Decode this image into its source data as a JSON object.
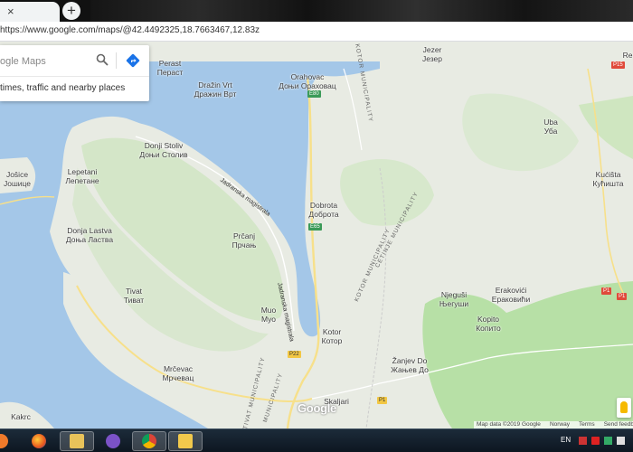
{
  "browser": {
    "url": "https://www.google.com/maps/@42.4492325,18.7663467,12.83z",
    "new_tab_symbol": "+",
    "tab_close_symbol": "×"
  },
  "search": {
    "placeholder": "ogle Maps",
    "hint": "times, traffic and nearby places"
  },
  "map": {
    "places": [
      {
        "latin": "Orahovac",
        "cyrillic": "Доњи Ораховац"
      },
      {
        "latin": "Jezer",
        "cyrillic": "Језер"
      },
      {
        "latin": "Perast",
        "cyrillic": "Пераст"
      },
      {
        "latin": "Dražin Vrt",
        "cyrillic": "Дражин Врт"
      },
      {
        "latin": "Donji Stoliv",
        "cyrillic": "Доњи Столив"
      },
      {
        "latin": "Uba",
        "cyrillic": "Уба"
      },
      {
        "latin": "Kućišta",
        "cyrillic": "Кућишта"
      },
      {
        "latin": "Lepetani",
        "cyrillic": "Лепетане"
      },
      {
        "latin": "Jošice",
        "cyrillic": "Јошице"
      },
      {
        "latin": "Dobrota",
        "cyrillic": "Доброта"
      },
      {
        "latin": "Donja Lastva",
        "cyrillic": "Доња Ластва"
      },
      {
        "latin": "Prčanj",
        "cyrillic": "Прчањ"
      },
      {
        "latin": "Tivat",
        "cyrillic": "Тиват"
      },
      {
        "latin": "Njeguši",
        "cyrillic": "Његуши"
      },
      {
        "latin": "Erakovići",
        "cyrillic": "Ераковићи"
      },
      {
        "latin": "Kopito",
        "cyrillic": "Копито"
      },
      {
        "latin": "Muo",
        "cyrillic": "Муо"
      },
      {
        "latin": "Kotor",
        "cyrillic": "Котор"
      },
      {
        "latin": "Žanjev Do",
        "cyrillic": "Жањев До"
      },
      {
        "latin": "Mrčevac",
        "cyrillic": "Мрчевац"
      },
      {
        "latin": "Skaljari",
        "cyrillic": ""
      },
      {
        "latin": "Kakrc",
        "cyrillic": ""
      }
    ],
    "municipalities": [
      "KOTOR MUNICIPALITY",
      "CETINJE MUNICIPALITY",
      "TIVAT MUNICIPALITY",
      "KOTOR MUNICIPALITY",
      "MUNICIPALITY"
    ],
    "roads": [
      "Jadranska magistrala",
      "Jadranska magistrala"
    ],
    "shields": [
      "E80",
      "E65",
      "P22",
      "P1",
      "P1",
      "P15",
      "P1"
    ],
    "partial_right_label": "Re",
    "google_logo": "Google",
    "attribution": [
      "Map data ©2019 Google",
      "Norway",
      "Terms",
      "Send feedback"
    ]
  },
  "taskbar": {
    "language": "EN"
  },
  "colors": {
    "water": "#a4c7e8",
    "land": "#e8ebe3",
    "forest": "#b7e0a6",
    "road": "#f7e08a",
    "taskbar": "#15212d"
  }
}
